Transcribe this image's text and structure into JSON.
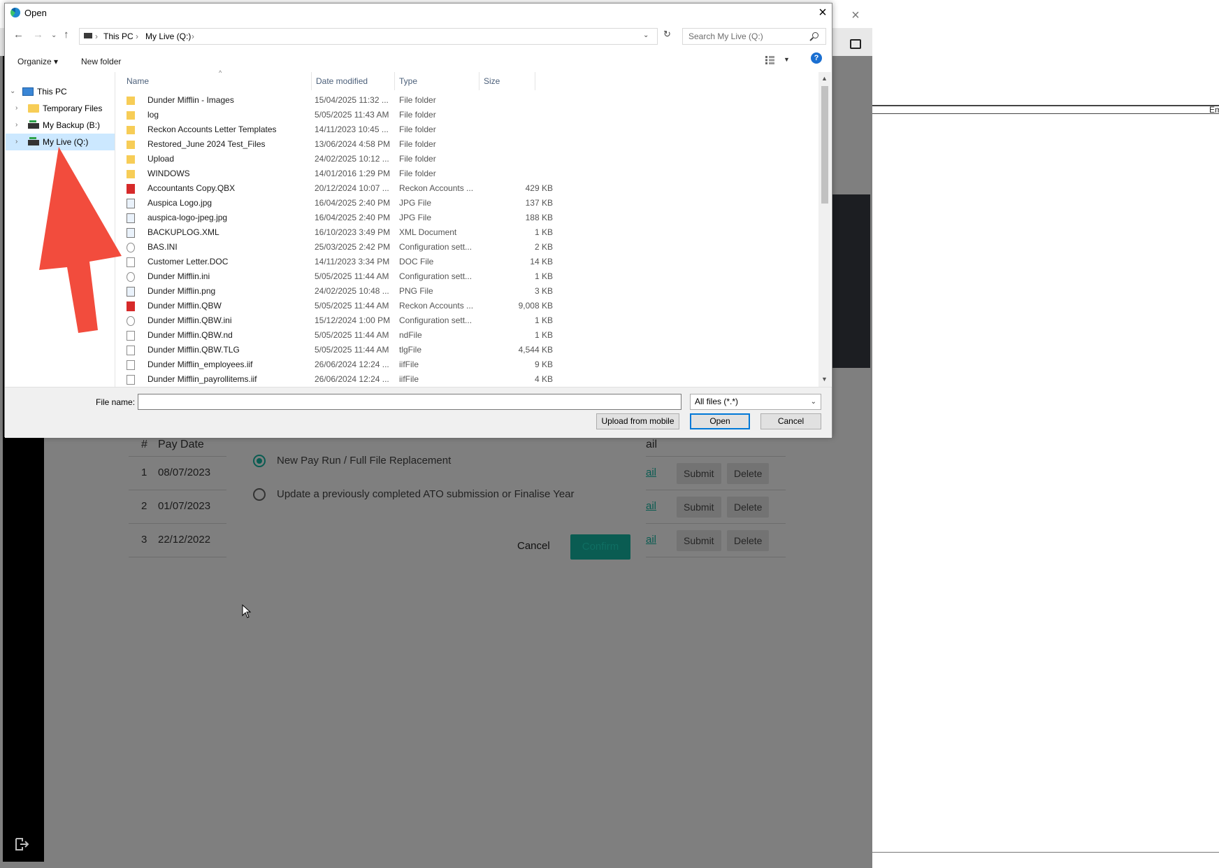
{
  "background_app": {
    "table": {
      "headers": [
        "#",
        "Pay Date",
        "ail"
      ],
      "rows": [
        {
          "num": "1",
          "date": "08/07/2023",
          "link": "ail",
          "submit": "Submit",
          "delete": "Delete"
        },
        {
          "num": "2",
          "date": "01/07/2023",
          "link": "ail",
          "submit": "Submit",
          "delete": "Delete"
        },
        {
          "num": "3",
          "date": "22/12/2022",
          "link": "ail",
          "submit": "Submit",
          "delete": "Delete"
        }
      ]
    },
    "right_pane_text": "Em",
    "modal": {
      "option_1": "New Pay Run / Full File Replacement",
      "option_2": "Update a previously completed ATO submission or Finalise Year",
      "cancel": "Cancel",
      "confirm": "Confirm",
      "selected_option": 1
    },
    "colors": {
      "accent": "#0a5c52",
      "overlay": "#7f7f7f",
      "sidebar": "#000000"
    }
  },
  "dialog": {
    "title": "Open",
    "breadcrumb": [
      "This PC",
      "My Live (Q:)"
    ],
    "search_placeholder": "Search My Live (Q:)",
    "commands": {
      "organize": "Organize ▾",
      "new_folder": "New folder"
    },
    "nav_tree": [
      {
        "label": "This PC",
        "icon": "pc-icon",
        "selected": false
      },
      {
        "label": "Temporary Files",
        "icon": "folder-icon",
        "selected": false
      },
      {
        "label": "My Backup (B:)",
        "icon": "drive-icon",
        "selected": false
      },
      {
        "label": "My Live (Q:)",
        "icon": "drive-icon",
        "selected": true
      }
    ],
    "columns": [
      "Name",
      "Date modified",
      "Type",
      "Size"
    ],
    "files": [
      {
        "name": "Dunder Mifflin - Images",
        "date": "15/04/2025 11:32 ...",
        "type": "File folder",
        "size": "",
        "icon": "folder"
      },
      {
        "name": "log",
        "date": "5/05/2025 11:43 AM",
        "type": "File folder",
        "size": "",
        "icon": "folder"
      },
      {
        "name": "Reckon Accounts Letter Templates",
        "date": "14/11/2023 10:45 ...",
        "type": "File folder",
        "size": "",
        "icon": "folder"
      },
      {
        "name": "Restored_June 2024 Test_Files",
        "date": "13/06/2024 4:58 PM",
        "type": "File folder",
        "size": "",
        "icon": "folder"
      },
      {
        "name": "Upload",
        "date": "24/02/2025 10:12 ...",
        "type": "File folder",
        "size": "",
        "icon": "folder"
      },
      {
        "name": "WINDOWS",
        "date": "14/01/2016 1:29 PM",
        "type": "File folder",
        "size": "",
        "icon": "folder"
      },
      {
        "name": "Accountants Copy.QBX",
        "date": "20/12/2024 10:07 ...",
        "type": "Reckon Accounts ...",
        "size": "429 KB",
        "icon": "red"
      },
      {
        "name": "Auspica Logo.jpg",
        "date": "16/04/2025 2:40 PM",
        "type": "JPG File",
        "size": "137 KB",
        "icon": "img"
      },
      {
        "name": "auspica-logo-jpeg.jpg",
        "date": "16/04/2025 2:40 PM",
        "type": "JPG File",
        "size": "188 KB",
        "icon": "img"
      },
      {
        "name": "BACKUPLOG.XML",
        "date": "16/10/2023 3:49 PM",
        "type": "XML Document",
        "size": "1 KB",
        "icon": "img"
      },
      {
        "name": "BAS.INI",
        "date": "25/03/2025 2:42 PM",
        "type": "Configuration sett...",
        "size": "2 KB",
        "icon": "cfg"
      },
      {
        "name": "Customer Letter.DOC",
        "date": "14/11/2023 3:34 PM",
        "type": "DOC File",
        "size": "14 KB",
        "icon": "doc"
      },
      {
        "name": "Dunder Mifflin.ini",
        "date": "5/05/2025 11:44 AM",
        "type": "Configuration sett...",
        "size": "1 KB",
        "icon": "cfg"
      },
      {
        "name": "Dunder Mifflin.png",
        "date": "24/02/2025 10:48 ...",
        "type": "PNG File",
        "size": "3 KB",
        "icon": "img"
      },
      {
        "name": "Dunder Mifflin.QBW",
        "date": "5/05/2025 11:44 AM",
        "type": "Reckon Accounts ...",
        "size": "9,008 KB",
        "icon": "red"
      },
      {
        "name": "Dunder Mifflin.QBW.ini",
        "date": "15/12/2024 1:00 PM",
        "type": "Configuration sett...",
        "size": "1 KB",
        "icon": "cfg"
      },
      {
        "name": "Dunder Mifflin.QBW.nd",
        "date": "5/05/2025 11:44 AM",
        "type": "ndFile",
        "size": "1 KB",
        "icon": "doc"
      },
      {
        "name": "Dunder Mifflin.QBW.TLG",
        "date": "5/05/2025 11:44 AM",
        "type": "tlgFile",
        "size": "4,544 KB",
        "icon": "doc"
      },
      {
        "name": "Dunder Mifflin_employees.iif",
        "date": "26/06/2024 12:24 ...",
        "type": "iifFile",
        "size": "9 KB",
        "icon": "doc"
      },
      {
        "name": "Dunder Mifflin_payrollitems.iif",
        "date": "26/06/2024 12:24 ...",
        "type": "iifFile",
        "size": "4 KB",
        "icon": "doc"
      }
    ],
    "file_name_label": "File name:",
    "file_name_value": "",
    "file_type": "All files (*.*)",
    "buttons": {
      "upload": "Upload from mobile",
      "open": "Open",
      "cancel": "Cancel"
    }
  }
}
